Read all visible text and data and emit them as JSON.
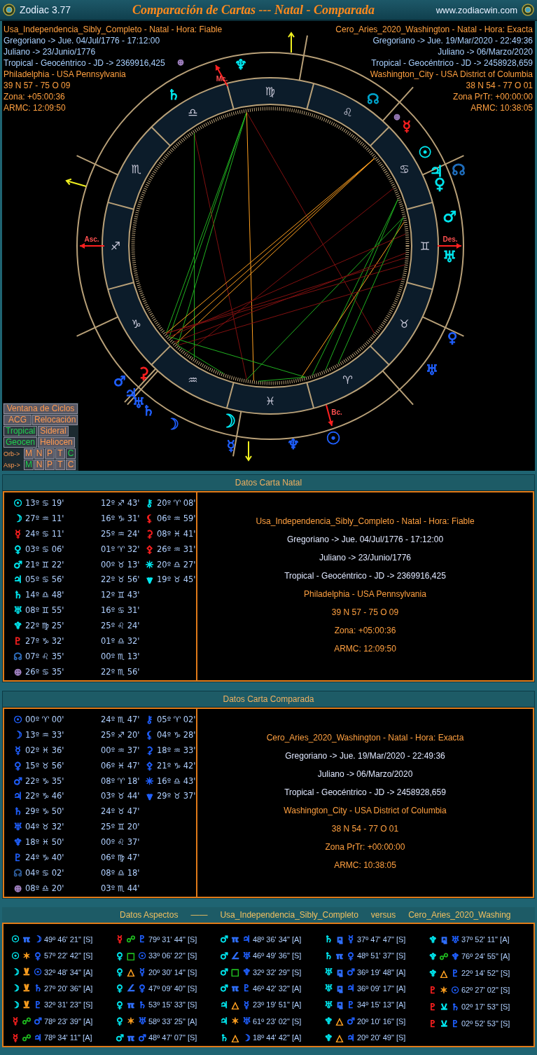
{
  "title_bar": {
    "app": "Zodiac 3.77",
    "title": "Comparación de Cartas --- Natal - Comparada",
    "website": "www.zodiacwin.com"
  },
  "chart_header": {
    "left": [
      {
        "text": "Usa_Independencia_Sibly_Completo - Natal - Hora: Fiable",
        "color": "#ffa040"
      },
      {
        "text": "Gregoriano -> Jue. 04/Jul/1776 - 17:12:00",
        "color": "#a8d0ff"
      },
      {
        "text": "Juliano -> 23/Junio/1776",
        "color": "#a8d0ff"
      },
      {
        "text": "Tropical - Geocéntrico - JD -> 2369916,425",
        "color": "#a8d0ff"
      },
      {
        "text": "Philadelphia - USA Pennsylvania",
        "color": "#ffa040"
      },
      {
        "text": "39 N 57 - 75 O 09",
        "color": "#ffa040"
      },
      {
        "text": "Zona: +05:00:36",
        "color": "#ffa040"
      },
      {
        "text": "ARMC: 12:09:50",
        "color": "#ffa040"
      }
    ],
    "right": [
      {
        "text": "Cero_Aries_2020_Washington - Natal - Hora: Exacta",
        "color": "#ffa040"
      },
      {
        "text": "Gregoriano -> Jue. 19/Mar/2020 - 22:49:36",
        "color": "#a8d0ff"
      },
      {
        "text": "Juliano -> 06/Marzo/2020",
        "color": "#a8d0ff"
      },
      {
        "text": "Tropical - Geocéntrico - JD -> 2458928,659",
        "color": "#a8d0ff"
      },
      {
        "text": "Washington_City - USA District of Columbia",
        "color": "#ffa040"
      },
      {
        "text": "38 N 54 - 77 O 01",
        "color": "#ffa040"
      },
      {
        "text": "Zona PrTr: +00:00:00",
        "color": "#ffa040"
      },
      {
        "text": "ARMC: 10:38:05",
        "color": "#ffa040"
      }
    ]
  },
  "wheel": {
    "signs": [
      "♈",
      "♉",
      "♊",
      "♋",
      "♌",
      "♍",
      "♎",
      "♏",
      "♐",
      "♑",
      "♒",
      "♓"
    ],
    "axes": [
      {
        "label": "Mc."
      },
      {
        "label": "Asc."
      },
      {
        "label": "Des."
      },
      {
        "label": "Bc."
      }
    ],
    "planets": [
      {
        "symbol": "♆",
        "color": "#00e8f0"
      },
      {
        "symbol": "♄",
        "color": "#00e8f0"
      },
      {
        "symbol": "⊕",
        "color": "#a080c0"
      },
      {
        "symbol": "☊",
        "color": "#00a8d0"
      },
      {
        "symbol": "⊕",
        "color": "#a080c0"
      },
      {
        "symbol": "☿",
        "color": "#ff2020"
      },
      {
        "symbol": "☉",
        "color": "#00e8f0"
      },
      {
        "symbol": "♃",
        "color": "#00e8f0"
      },
      {
        "symbol": "♀",
        "color": "#00e8f0"
      },
      {
        "symbol": "☊",
        "color": "#2070c0"
      },
      {
        "symbol": "♂",
        "color": "#00e8f0"
      },
      {
        "symbol": "♅",
        "color": "#00e8f0"
      },
      {
        "symbol": "♀",
        "color": "#2060ff"
      },
      {
        "symbol": "♅",
        "color": "#2060ff"
      },
      {
        "symbol": "☉",
        "color": "#2060ff"
      },
      {
        "symbol": "☿",
        "color": "#2060ff"
      },
      {
        "symbol": "♆",
        "color": "#2060ff"
      },
      {
        "symbol": "☽",
        "color": "#00e8f0"
      },
      {
        "symbol": "☽",
        "color": "#2060ff"
      },
      {
        "symbol": "⚳",
        "color": "#ff2020"
      },
      {
        "symbol": "♂",
        "color": "#2060ff"
      },
      {
        "symbol": "♃",
        "color": "#2060ff"
      },
      {
        "symbol": "♅",
        "color": "#2060ff"
      },
      {
        "symbol": "♄",
        "color": "#2060ff"
      }
    ]
  },
  "controls": [
    {
      "kind": "row",
      "buttons": [
        {
          "label": "Ventana de Ciclos",
          "selected": false
        }
      ]
    },
    {
      "kind": "row",
      "buttons": [
        {
          "label": "ACG",
          "selected": false
        },
        {
          "label": "Relocación",
          "selected": false
        }
      ]
    },
    {
      "kind": "row",
      "buttons": [
        {
          "label": "Tropical",
          "selected": true
        },
        {
          "label": "Sideral",
          "selected": false
        }
      ]
    },
    {
      "kind": "row",
      "buttons": [
        {
          "label": "Geocen",
          "selected": true
        },
        {
          "label": "Heliocen",
          "selected": false
        }
      ]
    },
    {
      "kind": "options",
      "label": "Orb->",
      "buttons": [
        {
          "label": "M",
          "selected": false
        },
        {
          "label": "N",
          "selected": false
        },
        {
          "label": "P",
          "selected": false
        },
        {
          "label": "T",
          "selected": false
        },
        {
          "label": "C",
          "selected": true
        }
      ]
    },
    {
      "kind": "options",
      "label": "Asp->",
      "buttons": [
        {
          "label": "M",
          "selected": true
        },
        {
          "label": "N",
          "selected": false
        },
        {
          "label": "P",
          "selected": false
        },
        {
          "label": "T",
          "selected": false
        },
        {
          "label": "C",
          "selected": false
        }
      ]
    }
  ],
  "panels": [
    {
      "title": "Datos Carta Natal",
      "planets": [
        {
          "symbol": "☉",
          "color": "#00e8f0",
          "position": "13º ♋ 19'"
        },
        {
          "symbol": "☽",
          "color": "#00e8f0",
          "position": "27º ♒ 11'"
        },
        {
          "symbol": "☿",
          "color": "#ff2020",
          "position": "24º ♋ 11'"
        },
        {
          "symbol": "♀",
          "color": "#00e8f0",
          "position": "03º ♋ 06'"
        },
        {
          "symbol": "♂",
          "color": "#00e8f0",
          "position": "21º ♊ 22'"
        },
        {
          "symbol": "♃",
          "color": "#00e8f0",
          "position": "05º ♋ 56'"
        },
        {
          "symbol": "♄",
          "color": "#00e8f0",
          "position": "14º ♎ 48'"
        },
        {
          "symbol": "♅",
          "color": "#00e8f0",
          "position": "08º ♊ 55'"
        },
        {
          "symbol": "♆",
          "color": "#00e8f0",
          "position": "22º ♍ 25'"
        },
        {
          "symbol": "♇",
          "color": "#ff2020",
          "position": "27º ♑ 32'"
        },
        {
          "symbol": "☊",
          "color": "#3070c0",
          "position": "07º ♌ 35'"
        },
        {
          "symbol": "⊕",
          "color": "#a080c0",
          "position": "26º ♋ 35'"
        }
      ],
      "cusps": [
        "12º ♐ 43'",
        "16º ♑ 31'",
        "25º ♒ 24'",
        "01º ♈ 32'",
        "00º ♉ 13'",
        "22º ♉ 56'",
        "12º ♊ 43'",
        "16º ♋ 31'",
        "25º ♌ 24'",
        "01º ♎ 32'",
        "00º ♏ 13'",
        "22º ♏ 56'"
      ],
      "points": [
        {
          "symbol": "⚷",
          "color": "#00e8f0",
          "position": "20º ♈ 08'"
        },
        {
          "symbol": "⚸",
          "color": "#ff2020",
          "position": "06º ♒ 59'"
        },
        {
          "symbol": "⚳",
          "color": "#ff2020",
          "position": "08º ♓ 41'"
        },
        {
          "symbol": "⚴",
          "color": "#ff2020",
          "position": "26º ♒ 31'"
        },
        {
          "symbol": "✳",
          "color": "#00e8f0",
          "position": "20º ♎ 27'"
        },
        {
          "symbol": "⩔",
          "color": "#00e8f0",
          "position": "19º ♉ 45'"
        }
      ],
      "details": [
        {
          "text": "Usa_Independencia_Sibly_Completo - Natal - Hora: Fiable",
          "color": "#ffa040"
        },
        {
          "text": "Gregoriano -> Jue. 04/Jul/1776 - 17:12:00",
          "color": "#e0e8ff"
        },
        {
          "text": "Juliano -> 23/Junio/1776",
          "color": "#e0e8ff"
        },
        {
          "text": "Tropical - Geocéntrico - JD -> 2369916,425",
          "color": "#e0e8ff"
        },
        {
          "text": "Philadelphia - USA Pennsylvania",
          "color": "#ffa040"
        },
        {
          "text": "39 N 57 - 75 O 09",
          "color": "#ffa040"
        },
        {
          "text": "Zona: +05:00:36",
          "color": "#ffa040"
        },
        {
          "text": "ARMC: 12:09:50",
          "color": "#ffa040"
        }
      ]
    },
    {
      "title": "Datos Carta Comparada",
      "planets": [
        {
          "symbol": "☉",
          "color": "#2060ff",
          "position": "00º ♈ 00'"
        },
        {
          "symbol": "☽",
          "color": "#2060ff",
          "position": "13º ♒ 33'"
        },
        {
          "symbol": "☿",
          "color": "#2060ff",
          "position": "02º ♓ 36'"
        },
        {
          "symbol": "♀",
          "color": "#2060ff",
          "position": "15º ♉ 56'"
        },
        {
          "symbol": "♂",
          "color": "#2060ff",
          "position": "22º ♑ 35'"
        },
        {
          "symbol": "♃",
          "color": "#2060ff",
          "position": "22º ♑ 46'"
        },
        {
          "symbol": "♄",
          "color": "#2060ff",
          "position": "29º ♑ 50'"
        },
        {
          "symbol": "♅",
          "color": "#2060ff",
          "position": "04º ♉ 32'"
        },
        {
          "symbol": "♆",
          "color": "#2060ff",
          "position": "18º ♓ 50'"
        },
        {
          "symbol": "♇",
          "color": "#2060ff",
          "position": "24º ♑ 40'"
        },
        {
          "symbol": "☊",
          "color": "#3060a0",
          "position": "04º ♋ 02'"
        },
        {
          "symbol": "⊕",
          "color": "#a080c0",
          "position": "08º ♎ 20'"
        }
      ],
      "cusps": [
        "24º ♏ 47'",
        "25º ♐ 20'",
        "00º ♒ 37'",
        "06º ♓ 47'",
        "08º ♈ 18'",
        "03º ♉ 44'",
        "24º ♉ 47'",
        "25º ♊ 20'",
        "00º ♌ 37'",
        "06º ♍ 47'",
        "08º ♎ 18'",
        "03º ♏ 44'"
      ],
      "points": [
        {
          "symbol": "⚷",
          "color": "#2060ff",
          "position": "05º ♈ 02'"
        },
        {
          "symbol": "⚸",
          "color": "#2060ff",
          "position": "04º ♑ 28'"
        },
        {
          "symbol": "⚳",
          "color": "#2060ff",
          "position": "18º ♒ 33'"
        },
        {
          "symbol": "⚴",
          "color": "#2060ff",
          "position": "21º ♑ 42'"
        },
        {
          "symbol": "✳",
          "color": "#2060ff",
          "position": "16º ♎ 43'"
        },
        {
          "symbol": "⩔",
          "color": "#2060ff",
          "position": "29º ♉ 37'"
        }
      ],
      "details": [
        {
          "text": "Cero_Aries_2020_Washington - Natal - Hora: Exacta",
          "color": "#ffa040"
        },
        {
          "text": "Gregoriano -> Jue. 19/Mar/2020 - 22:49:36",
          "color": "#e0e8ff"
        },
        {
          "text": "Juliano -> 06/Marzo/2020",
          "color": "#e0e8ff"
        },
        {
          "text": "Tropical - Geocéntrico - JD -> 2458928,659",
          "color": "#e0e8ff"
        },
        {
          "text": "Washington_City - USA District of Columbia",
          "color": "#ffa040"
        },
        {
          "text": "38 N 54 - 77 O 01",
          "color": "#ffa040"
        },
        {
          "text": "Zona PrTr: +00:00:00",
          "color": "#ffa040"
        },
        {
          "text": "ARMC: 10:38:05",
          "color": "#ffa040"
        }
      ]
    }
  ],
  "aspects_panel": {
    "header": [
      "Datos Aspectos",
      "——",
      "Usa_Independencia_Sibly_Completo",
      "versus",
      "Cero_Aries_2020_Washing"
    ],
    "columns": [
      [
        {
          "planet1": {
            "symbol": "☉",
            "color": "#00e8f0"
          },
          "aspect": {
            "symbol": "π",
            "color": "#3070ff"
          },
          "planet2": {
            "symbol": "☽",
            "color": "#2060ff"
          },
          "value": "49º 46' 21\" [S]"
        },
        {
          "planet1": {
            "symbol": "☉",
            "color": "#00e8f0"
          },
          "aspect": {
            "symbol": "✶",
            "color": "#ffa020"
          },
          "planet2": {
            "symbol": "♀",
            "color": "#2060ff"
          },
          "value": "57º 22' 42\" [S]"
        },
        {
          "planet1": {
            "symbol": "☽",
            "color": "#00e8f0"
          },
          "aspect": {
            "symbol": "⊻",
            "color": "#ffa020"
          },
          "planet2": {
            "symbol": "☉",
            "color": "#2060ff"
          },
          "value": "32º 48' 34\" [A]"
        },
        {
          "planet1": {
            "symbol": "☽",
            "color": "#00e8f0"
          },
          "aspect": {
            "symbol": "⊻",
            "color": "#ffa020"
          },
          "planet2": {
            "symbol": "♄",
            "color": "#2060ff"
          },
          "value": "27º 20' 36\" [A]"
        },
        {
          "planet1": {
            "symbol": "☽",
            "color": "#00e8f0"
          },
          "aspect": {
            "symbol": "⊻",
            "color": "#ffa020"
          },
          "planet2": {
            "symbol": "♇",
            "color": "#2060ff"
          },
          "value": "32º 31' 23\" [S]"
        },
        {
          "planet1": {
            "symbol": "☿",
            "color": "#ff2020"
          },
          "aspect": {
            "symbol": "☍",
            "color": "#20c020"
          },
          "planet2": {
            "symbol": "♂",
            "color": "#2060ff"
          },
          "value": "78º 23' 39\" [A]"
        },
        {
          "planet1": {
            "symbol": "☿",
            "color": "#ff2020"
          },
          "aspect": {
            "symbol": "☍",
            "color": "#20c020"
          },
          "planet2": {
            "symbol": "♃",
            "color": "#2060ff"
          },
          "value": "78º 34' 11\" [A]"
        }
      ],
      [
        {
          "planet1": {
            "symbol": "☿",
            "color": "#ff2020"
          },
          "aspect": {
            "symbol": "☍",
            "color": "#20c020"
          },
          "planet2": {
            "symbol": "♇",
            "color": "#2060ff"
          },
          "value": "79º 31' 44\" [S]"
        },
        {
          "planet1": {
            "symbol": "♀",
            "color": "#00e8f0"
          },
          "aspect": {
            "symbol": "□",
            "color": "#20c020"
          },
          "planet2": {
            "symbol": "☉",
            "color": "#2060ff"
          },
          "value": "33º 06' 22\" [S]"
        },
        {
          "planet1": {
            "symbol": "♀",
            "color": "#00e8f0"
          },
          "aspect": {
            "symbol": "△",
            "color": "#ffa020"
          },
          "planet2": {
            "symbol": "☿",
            "color": "#2060ff"
          },
          "value": "20º 30' 14\" [S]"
        },
        {
          "planet1": {
            "symbol": "♀",
            "color": "#00e8f0"
          },
          "aspect": {
            "symbol": "∠",
            "color": "#3070ff"
          },
          "planet2": {
            "symbol": "♀",
            "color": "#2060ff"
          },
          "value": "47º 09' 40\" [S]"
        },
        {
          "planet1": {
            "symbol": "♀",
            "color": "#00e8f0"
          },
          "aspect": {
            "symbol": "π",
            "color": "#3070ff"
          },
          "planet2": {
            "symbol": "♄",
            "color": "#2060ff"
          },
          "value": "53º 15' 33\" [S]"
        },
        {
          "planet1": {
            "symbol": "♀",
            "color": "#00e8f0"
          },
          "aspect": {
            "symbol": "✶",
            "color": "#ffa020"
          },
          "planet2": {
            "symbol": "♅",
            "color": "#2060ff"
          },
          "value": "58º 33' 25\" [A]"
        },
        {
          "planet1": {
            "symbol": "♂",
            "color": "#00e8f0"
          },
          "aspect": {
            "symbol": "π",
            "color": "#3070ff"
          },
          "planet2": {
            "symbol": "♂",
            "color": "#2060ff"
          },
          "value": "48º 47' 07\" [S]"
        }
      ],
      [
        {
          "planet1": {
            "symbol": "♂",
            "color": "#00e8f0"
          },
          "aspect": {
            "symbol": "π",
            "color": "#3070ff"
          },
          "planet2": {
            "symbol": "♃",
            "color": "#2060ff"
          },
          "value": "48º 36' 34\" [A]"
        },
        {
          "planet1": {
            "symbol": "♂",
            "color": "#00e8f0"
          },
          "aspect": {
            "symbol": "∠",
            "color": "#3070ff"
          },
          "planet2": {
            "symbol": "♅",
            "color": "#2060ff"
          },
          "value": "46º 49' 36\" [S]"
        },
        {
          "planet1": {
            "symbol": "♂",
            "color": "#00e8f0"
          },
          "aspect": {
            "symbol": "□",
            "color": "#20c020"
          },
          "planet2": {
            "symbol": "♆",
            "color": "#2060ff"
          },
          "value": "32º 32' 29\" [S]"
        },
        {
          "planet1": {
            "symbol": "♂",
            "color": "#00e8f0"
          },
          "aspect": {
            "symbol": "π",
            "color": "#3070ff"
          },
          "planet2": {
            "symbol": "♇",
            "color": "#2060ff"
          },
          "value": "46º 42' 32\" [A]"
        },
        {
          "planet1": {
            "symbol": "♃",
            "color": "#00e8f0"
          },
          "aspect": {
            "symbol": "△",
            "color": "#ffa020"
          },
          "planet2": {
            "symbol": "☿",
            "color": "#2060ff"
          },
          "value": "23º 19' 51\" [A]"
        },
        {
          "planet1": {
            "symbol": "♃",
            "color": "#00e8f0"
          },
          "aspect": {
            "symbol": "✶",
            "color": "#ffa020"
          },
          "planet2": {
            "symbol": "♅",
            "color": "#2060ff"
          },
          "value": "61º 23' 02\" [S]"
        },
        {
          "planet1": {
            "symbol": "♄",
            "color": "#00e8f0"
          },
          "aspect": {
            "symbol": "△",
            "color": "#ffa020"
          },
          "planet2": {
            "symbol": "☽",
            "color": "#2060ff"
          },
          "value": "18º 44' 42\" [A]"
        }
      ],
      [
        {
          "planet1": {
            "symbol": "♄",
            "color": "#00e8f0"
          },
          "aspect": {
            "symbol": "⚼",
            "color": "#3070ff"
          },
          "planet2": {
            "symbol": "☿",
            "color": "#2060ff"
          },
          "value": "37º 47' 47\" [S]"
        },
        {
          "planet1": {
            "symbol": "♄",
            "color": "#00e8f0"
          },
          "aspect": {
            "symbol": "π",
            "color": "#3070ff"
          },
          "planet2": {
            "symbol": "♀",
            "color": "#2060ff"
          },
          "value": "48º 51' 37\" [S]"
        },
        {
          "planet1": {
            "symbol": "♅",
            "color": "#00e8f0"
          },
          "aspect": {
            "symbol": "⚼",
            "color": "#3070ff"
          },
          "planet2": {
            "symbol": "♂",
            "color": "#2060ff"
          },
          "value": "36º 19' 48\" [A]"
        },
        {
          "planet1": {
            "symbol": "♅",
            "color": "#00e8f0"
          },
          "aspect": {
            "symbol": "⚼",
            "color": "#3070ff"
          },
          "planet2": {
            "symbol": "♃",
            "color": "#2060ff"
          },
          "value": "36º 09' 17\" [A]"
        },
        {
          "planet1": {
            "symbol": "♅",
            "color": "#00e8f0"
          },
          "aspect": {
            "symbol": "⚼",
            "color": "#3070ff"
          },
          "planet2": {
            "symbol": "♇",
            "color": "#2060ff"
          },
          "value": "34º 15' 13\" [A]"
        },
        {
          "planet1": {
            "symbol": "♆",
            "color": "#00e8f0"
          },
          "aspect": {
            "symbol": "△",
            "color": "#ffa020"
          },
          "planet2": {
            "symbol": "♂",
            "color": "#2060ff"
          },
          "value": "20º 10' 16\" [S]"
        },
        {
          "planet1": {
            "symbol": "♆",
            "color": "#00e8f0"
          },
          "aspect": {
            "symbol": "△",
            "color": "#ffa020"
          },
          "planet2": {
            "symbol": "♃",
            "color": "#2060ff"
          },
          "value": "20º 20' 49\" [S]"
        }
      ],
      [
        {
          "planet1": {
            "symbol": "♆",
            "color": "#00e8f0"
          },
          "aspect": {
            "symbol": "⚼",
            "color": "#3070ff"
          },
          "planet2": {
            "symbol": "♅",
            "color": "#2060ff"
          },
          "value": "37º 52' 11\" [A]"
        },
        {
          "planet1": {
            "symbol": "♆",
            "color": "#00e8f0"
          },
          "aspect": {
            "symbol": "☍",
            "color": "#20c020"
          },
          "planet2": {
            "symbol": "♆",
            "color": "#2060ff"
          },
          "value": "76º 24' 55\" [A]"
        },
        {
          "planet1": {
            "symbol": "♆",
            "color": "#00e8f0"
          },
          "aspect": {
            "symbol": "△",
            "color": "#ffa020"
          },
          "planet2": {
            "symbol": "♇",
            "color": "#2060ff"
          },
          "value": "22º 14' 52\" [S]"
        },
        {
          "planet1": {
            "symbol": "♇",
            "color": "#ff2020"
          },
          "aspect": {
            "symbol": "✶",
            "color": "#ffa020"
          },
          "planet2": {
            "symbol": "☉",
            "color": "#2060ff"
          },
          "value": "62º 27' 02\" [S]"
        },
        {
          "planet1": {
            "symbol": "♇",
            "color": "#ff2020"
          },
          "aspect": {
            "symbol": "⚺",
            "color": "#00e8f0"
          },
          "planet2": {
            "symbol": "♄",
            "color": "#2060ff"
          },
          "value": "02º 17' 53\" [S]"
        },
        {
          "planet1": {
            "symbol": "♇",
            "color": "#ff2020"
          },
          "aspect": {
            "symbol": "⚺",
            "color": "#00e8f0"
          },
          "planet2": {
            "symbol": "♇",
            "color": "#2060ff"
          },
          "value": "02º 52' 53\" [S]"
        }
      ]
    ]
  }
}
